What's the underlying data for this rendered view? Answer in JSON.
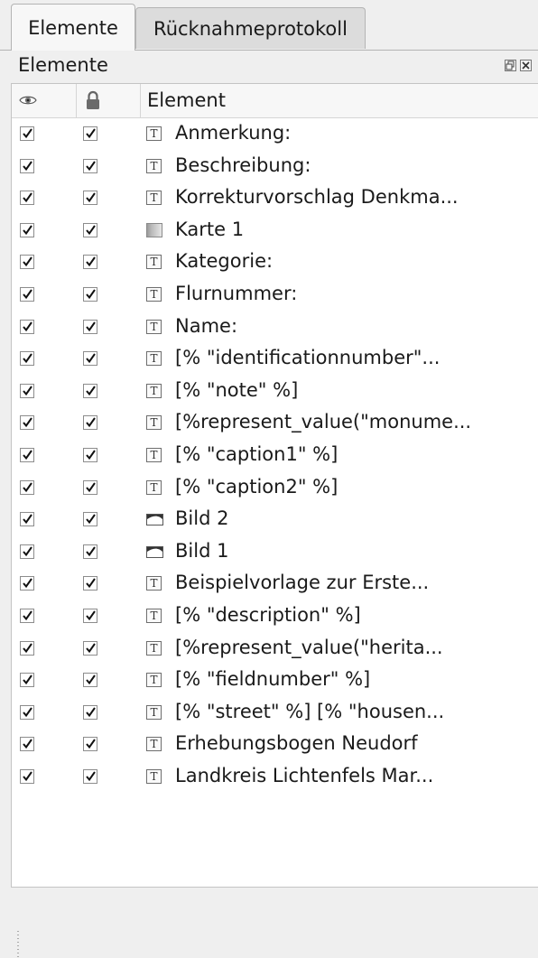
{
  "tabs": [
    {
      "label": "Elemente",
      "active": true
    },
    {
      "label": "Rücknahmeprotokoll",
      "active": false
    }
  ],
  "dock": {
    "title": "Elemente"
  },
  "table": {
    "columns": [
      {
        "label": "",
        "icon": "eye-icon"
      },
      {
        "label": "",
        "icon": "lock-icon"
      },
      {
        "label": "Element"
      }
    ],
    "rows": [
      {
        "visible": true,
        "locked": true,
        "icon": "text-icon",
        "label": "Anmerkung:"
      },
      {
        "visible": true,
        "locked": true,
        "icon": "text-icon",
        "label": "Beschreibung:"
      },
      {
        "visible": true,
        "locked": true,
        "icon": "text-icon",
        "label": "Korrekturvorschlag Denkma..."
      },
      {
        "visible": true,
        "locked": true,
        "icon": "map-icon",
        "label": "Karte 1"
      },
      {
        "visible": true,
        "locked": true,
        "icon": "text-icon",
        "label": "Kategorie:"
      },
      {
        "visible": true,
        "locked": true,
        "icon": "text-icon",
        "label": "Flurnummer:"
      },
      {
        "visible": true,
        "locked": true,
        "icon": "text-icon",
        "label": "Name:"
      },
      {
        "visible": true,
        "locked": true,
        "icon": "text-icon",
        "label": "[% \"identificationnumber\"..."
      },
      {
        "visible": true,
        "locked": true,
        "icon": "text-icon",
        "label": "[% \"note\" %]"
      },
      {
        "visible": true,
        "locked": true,
        "icon": "text-icon",
        "label": "[%represent_value(\"monume..."
      },
      {
        "visible": true,
        "locked": true,
        "icon": "text-icon",
        "label": "[% \"caption1\" %]"
      },
      {
        "visible": true,
        "locked": true,
        "icon": "text-icon",
        "label": "[% \"caption2\" %]"
      },
      {
        "visible": true,
        "locked": true,
        "icon": "picture-icon",
        "label": "Bild 2"
      },
      {
        "visible": true,
        "locked": true,
        "icon": "picture-icon",
        "label": "Bild 1"
      },
      {
        "visible": true,
        "locked": true,
        "icon": "text-icon",
        "label": "Beispielvorlage zur Erste..."
      },
      {
        "visible": true,
        "locked": true,
        "icon": "text-icon",
        "label": "[% \"description\" %]"
      },
      {
        "visible": true,
        "locked": true,
        "icon": "text-icon",
        "label": "[%represent_value(\"herita..."
      },
      {
        "visible": true,
        "locked": true,
        "icon": "text-icon",
        "label": "[% \"fieldnumber\" %]"
      },
      {
        "visible": true,
        "locked": true,
        "icon": "text-icon",
        "label": "[% \"street\" %] [% \"housen..."
      },
      {
        "visible": true,
        "locked": true,
        "icon": "text-icon",
        "label": "Erhebungsbogen Neudorf"
      },
      {
        "visible": true,
        "locked": true,
        "icon": "text-icon",
        "label": "Landkreis Lichtenfels Mar..."
      }
    ]
  }
}
